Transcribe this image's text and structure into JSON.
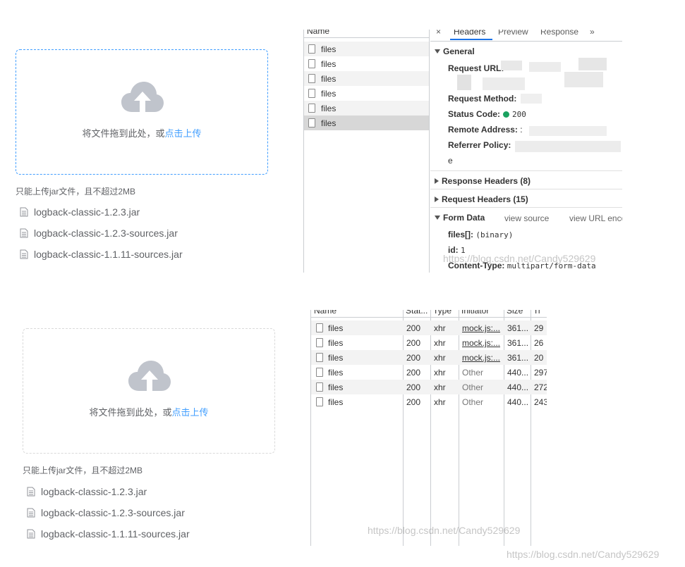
{
  "upload_top": {
    "drag_text": "将文件拖到此处，或",
    "click_text": "点击上传",
    "tip": "只能上传jar文件，且不超过2MB",
    "files": [
      "logback-classic-1.2.3.jar",
      "logback-classic-1.2.3-sources.jar",
      "logback-classic-1.1.11-sources.jar"
    ]
  },
  "upload_bottom": {
    "drag_text": "将文件拖到此处，或",
    "click_text": "点击上传",
    "tip": "只能上传jar文件，且不超过2MB",
    "files": [
      "logback-classic-1.2.3.jar",
      "logback-classic-1.2.3-sources.jar",
      "logback-classic-1.1.11-sources.jar"
    ]
  },
  "devtools_detail": {
    "name_header": "Name",
    "requests": [
      "files",
      "files",
      "files",
      "files",
      "files",
      "files"
    ],
    "tabs": {
      "close": "×",
      "headers": "Headers",
      "preview": "Preview",
      "response": "Response",
      "more": "»"
    },
    "general": {
      "title": "General",
      "request_url_label": "Request URL:",
      "request_method_label": "Request Method:",
      "status_code_label": "Status Code:",
      "status_code_value": "200",
      "remote_address_label": "Remote Address:",
      "remote_address_value": ":",
      "referrer_policy_label": "Referrer Policy:",
      "referrer_policy_tail": "e"
    },
    "response_headers": "Response Headers (8)",
    "request_headers": "Request Headers (15)",
    "form_data": {
      "title": "Form Data",
      "view_source": "view source",
      "view_url": "view URL enco",
      "files_label": "files[]:",
      "files_value": "(binary)",
      "id_label": "id:",
      "id_value": "1",
      "content_type_label": "Content-Type:",
      "content_type_value": "multipart/form-data"
    },
    "watermark": "https://blog.csdn.net/Candy529629"
  },
  "devtools_network": {
    "columns": {
      "name": "Name",
      "status": "Stat...",
      "type": "Type",
      "initiator": "Initiator",
      "size": "Size",
      "time": "Ti"
    },
    "rows": [
      {
        "name": "files",
        "status": "200",
        "type": "xhr",
        "initiator": "mock.js:...",
        "size": "361...",
        "time": "29",
        "link": true
      },
      {
        "name": "files",
        "status": "200",
        "type": "xhr",
        "initiator": "mock.js:...",
        "size": "361...",
        "time": "26",
        "link": true
      },
      {
        "name": "files",
        "status": "200",
        "type": "xhr",
        "initiator": "mock.js:...",
        "size": "361...",
        "time": "20",
        "link": true
      },
      {
        "name": "files",
        "status": "200",
        "type": "xhr",
        "initiator": "Other",
        "size": "440...",
        "time": "297",
        "link": false
      },
      {
        "name": "files",
        "status": "200",
        "type": "xhr",
        "initiator": "Other",
        "size": "440...",
        "time": "272",
        "link": false
      },
      {
        "name": "files",
        "status": "200",
        "type": "xhr",
        "initiator": "Other",
        "size": "440...",
        "time": "243",
        "link": false
      }
    ],
    "watermark": "https://blog.csdn.net/Candy529629"
  },
  "page_watermark": "https://blog.csdn.net/Candy529629"
}
